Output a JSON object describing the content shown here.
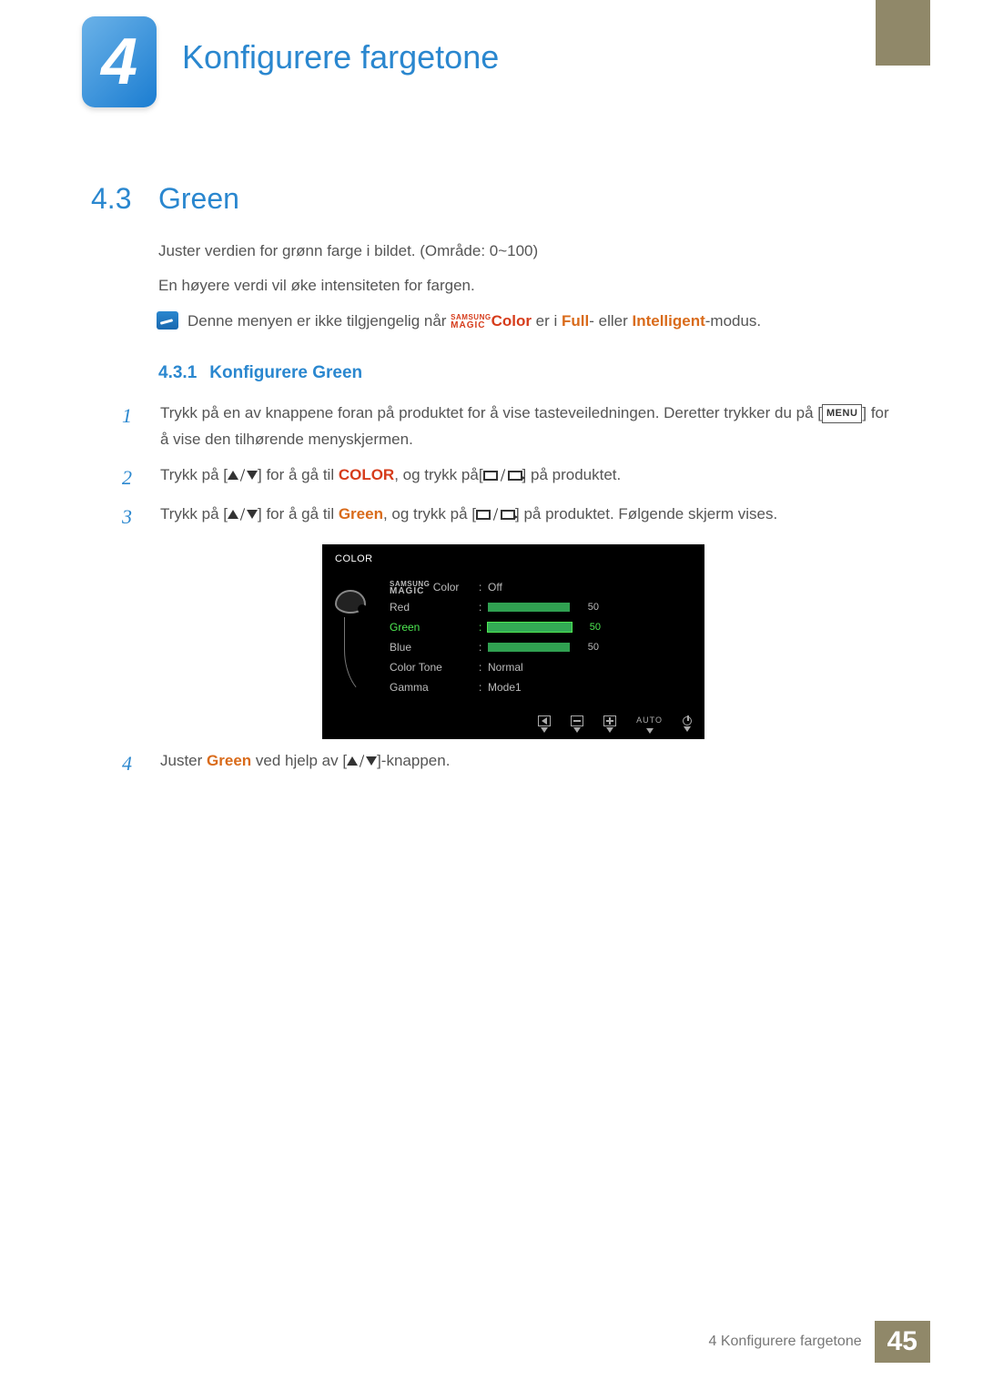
{
  "chapter": {
    "number": "4",
    "title": "Konfigurere fargetone"
  },
  "section": {
    "number": "4.3",
    "title": "Green"
  },
  "intro": {
    "p1": "Juster verdien for grønn farge i bildet. (Område: 0~100)",
    "p2": "En høyere verdi vil øke intensiteten for fargen."
  },
  "note": {
    "pre": "Denne menyen er ikke tilgjengelig når ",
    "magic_top": "SAMSUNG",
    "magic_bot": "MAGIC",
    "magic_word": "Color",
    "mid": " er i ",
    "full": "Full",
    "or": "- eller ",
    "intel": "Intelligent",
    "post": "-modus."
  },
  "subsection": {
    "number": "4.3.1",
    "title": "Konfigurere Green"
  },
  "steps": {
    "s1a": "Trykk på en av knappene foran på produktet for å vise tasteveiledningen. Deretter trykker du på [",
    "s1_menu": "MENU",
    "s1b": "] for å vise den tilhørende menyskjermen.",
    "s2a": "Trykk på [",
    "s2b": "] for å gå til ",
    "s2_color": "COLOR",
    "s2c": ", og trykk på[",
    "s2d": "] på produktet.",
    "s3a": "Trykk på [",
    "s3b": "] for å gå til ",
    "s3_green": "Green",
    "s3c": ", og trykk på [",
    "s3d": "] på produktet. Følgende skjerm vises.",
    "s4a": "Juster ",
    "s4_green": "Green",
    "s4b": " ved hjelp av [",
    "s4c": "]-knappen."
  },
  "osd": {
    "title": "COLOR",
    "rows": [
      {
        "label": "Color",
        "prefix_top": "SAMSUNG",
        "prefix_bot": "MAGIC",
        "value": "Off"
      },
      {
        "label": "Red",
        "bar": 50,
        "num": "50"
      },
      {
        "label": "Green",
        "bar": 50,
        "num": "50",
        "selected": true
      },
      {
        "label": "Blue",
        "bar": 50,
        "num": "50"
      },
      {
        "label": "Color Tone",
        "value": "Normal"
      },
      {
        "label": "Gamma",
        "value": "Mode1"
      }
    ],
    "auto": "AUTO"
  },
  "footer": {
    "text": "4 Konfigurere fargetone",
    "page": "45"
  }
}
